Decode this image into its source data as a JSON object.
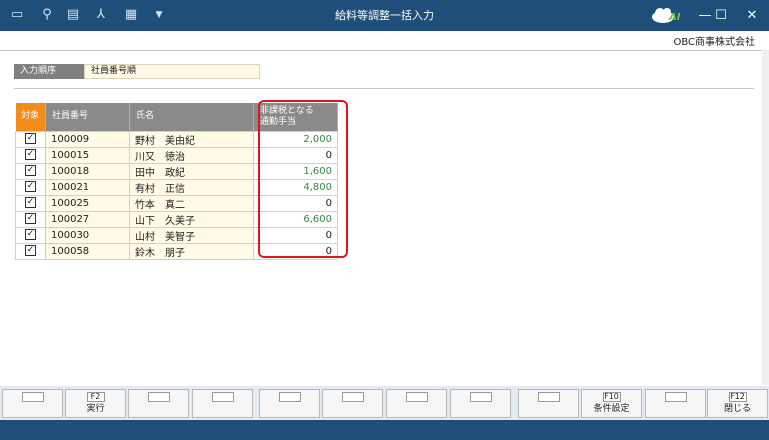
{
  "window": {
    "title": "給料等調整一括入力"
  },
  "toolbar": [
    {
      "icon": "window-icon",
      "glyph": "▭"
    },
    {
      "icon": "search-icon",
      "glyph": "⚲"
    },
    {
      "icon": "print-icon",
      "glyph": "▤"
    },
    {
      "icon": "pdf-icon",
      "glyph": "⅄"
    },
    {
      "icon": "excel-icon",
      "glyph": "▦"
    },
    {
      "icon": "dropdown-icon",
      "glyph": "▼"
    }
  ],
  "ai_badge": "AI",
  "window_controls": {
    "minimize": "—",
    "maximize": "☐",
    "close": "✕"
  },
  "company": "OBC商事株式会社",
  "order": {
    "label": "入力順序",
    "value": "社員番号順"
  },
  "table": {
    "headers": {
      "target": "対象",
      "emp_no": "社員番号",
      "name": "氏名",
      "amount_line1": "非課税となる",
      "amount_line2": "通勤手当"
    },
    "rows": [
      {
        "checked": true,
        "emp_no": "100009",
        "name": "野村　美由紀",
        "amount": "2,000"
      },
      {
        "checked": true,
        "emp_no": "100015",
        "name": "川又　徳治",
        "amount": "0"
      },
      {
        "checked": true,
        "emp_no": "100018",
        "name": "田中　政紀",
        "amount": "1,600"
      },
      {
        "checked": true,
        "emp_no": "100021",
        "name": "有村　正信",
        "amount": "4,800"
      },
      {
        "checked": true,
        "emp_no": "100025",
        "name": "竹本　真二",
        "amount": "0"
      },
      {
        "checked": true,
        "emp_no": "100027",
        "name": "山下　久美子",
        "amount": "6,600"
      },
      {
        "checked": true,
        "emp_no": "100030",
        "name": "山村　美智子",
        "amount": "0"
      },
      {
        "checked": true,
        "emp_no": "100058",
        "name": "鈴木　朋子",
        "amount": "0"
      }
    ]
  },
  "fkeys": [
    {
      "key": "",
      "label": ""
    },
    {
      "key": "F2",
      "label": "実行"
    },
    {
      "key": "",
      "label": ""
    },
    {
      "key": "",
      "label": ""
    },
    {
      "key": "",
      "label": ""
    },
    {
      "key": "",
      "label": ""
    },
    {
      "key": "",
      "label": ""
    },
    {
      "key": "",
      "label": ""
    },
    {
      "key": "",
      "label": ""
    },
    {
      "key": "F10",
      "label": "条件設定"
    },
    {
      "key": "",
      "label": ""
    },
    {
      "key": "F12",
      "label": "閉じる"
    }
  ],
  "colors": {
    "titlebar": "#1e4e79",
    "target_header": "#f28c1c",
    "amount_positive": "#2e8b3c",
    "highlight": "#e0141c"
  }
}
